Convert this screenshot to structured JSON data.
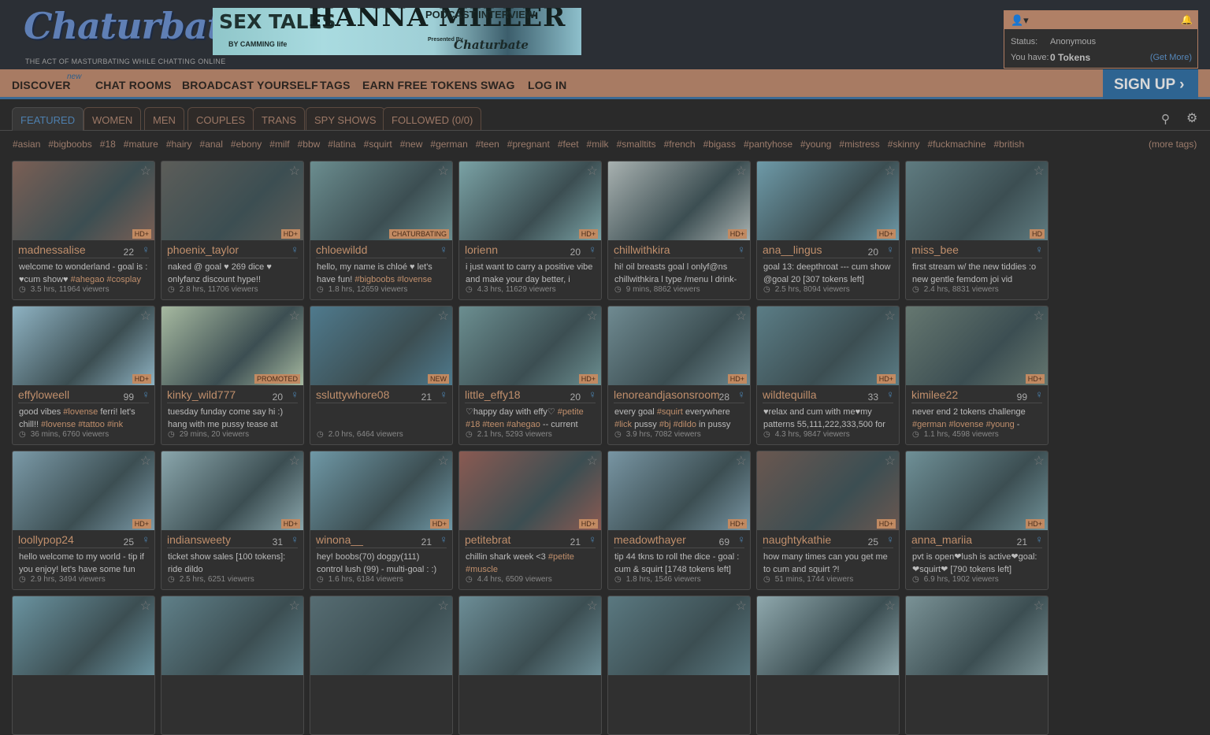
{
  "header": {
    "logo": "Chaturbate",
    "tagline": "THE ACT OF MASTURBATING WHILE CHATTING ONLINE",
    "banner": {
      "left": "SEX TALES",
      "by": "BY CAMMING life",
      "name": "HANNA MILLER",
      "right": "PODCAST INTERVIEW",
      "presented": "Presented By",
      "brand": "Chaturbate"
    }
  },
  "userbox": {
    "status_label": "Status:",
    "status_value": "Anonymous",
    "have_label": "You have:",
    "tokens": "0 Tokens",
    "get_more": "(Get More)",
    "user_icon": "user-icon",
    "bell_icon": "bell-icon"
  },
  "nav": {
    "items": [
      "DISCOVER",
      "CHAT ROOMS",
      "BROADCAST YOURSELF",
      "TAGS",
      "EARN FREE TOKENS",
      "SWAG",
      "LOG IN"
    ],
    "new_badge": "new",
    "signup": "SIGN UP"
  },
  "tabs": [
    "FEATURED",
    "WOMEN",
    "MEN",
    "COUPLES",
    "TRANS",
    "SPY SHOWS",
    "FOLLOWED (0/0)"
  ],
  "tags": [
    "#asian",
    "#bigboobs",
    "#18",
    "#mature",
    "#hairy",
    "#anal",
    "#ebony",
    "#milf",
    "#bbw",
    "#latina",
    "#squirt",
    "#new",
    "#german",
    "#teen",
    "#pregnant",
    "#feet",
    "#milk",
    "#smalltits",
    "#french",
    "#bigass",
    "#pantyhose",
    "#young",
    "#mistress",
    "#skinny",
    "#fuckmachine",
    "#british"
  ],
  "more_tags": "(more tags)",
  "colors": {
    "accent": "#a87b63",
    "link": "#4d7fae",
    "username": "#c08f6c",
    "signup": "#2e6491"
  },
  "rooms": [
    {
      "name": "madnessalise",
      "age": "22",
      "badge": "HD+",
      "subject": [
        "welcome to wonderland - goal is : ♥cum show♥ ",
        "#ahegao",
        " ",
        "#cosplay"
      ],
      "stats": "3.5 hrs, 11964 viewers",
      "tint": "#7a5f55"
    },
    {
      "name": "phoenix_taylor",
      "age": "",
      "badge": "HD+",
      "subject": [
        "naked @ goal ♥ 269 dice ♥ onlyfanz discount hype!!"
      ],
      "stats": "2.8 hrs, 11706 viewers",
      "tint": "#5c5d59"
    },
    {
      "name": "chloewildd",
      "age": "",
      "badge": "CHATURBATING",
      "subject": [
        "hello, my name is chloé ♥ let's have fun! ",
        "#bigboobs",
        " ",
        "#lovense"
      ],
      "stats": "1.8 hrs, 12659 viewers",
      "tint": "#6b8d8f"
    },
    {
      "name": "lorienn",
      "age": "20",
      "badge": "HD+",
      "subject": [
        "i just want to carry a positive vibe and make your day better, i"
      ],
      "stats": "4.3 hrs, 11629 viewers",
      "tint": "#7aa2a5"
    },
    {
      "name": "chillwithkira",
      "age": "",
      "badge": "HD+",
      "subject": [
        "hi! oil breasts goal l onlyf@ns chillwithkira l type /menu l drink-"
      ],
      "stats": "9 mins, 8862 viewers",
      "tint": "#a8b1b0"
    },
    {
      "name": "ana__lingus",
      "age": "20",
      "badge": "HD+",
      "subject": [
        "goal 13: deepthroat --- cum show @goal 20 [307 tokens left]"
      ],
      "stats": "2.5 hrs, 8094 viewers",
      "tint": "#6e9aa8"
    },
    {
      "name": "miss_bee",
      "age": "",
      "badge": "HD",
      "subject": [
        "first stream w/ the new tiddies :o new gentle femdom joi vid"
      ],
      "stats": "2.4 hrs, 8831 viewers",
      "tint": "#5f7b80"
    },
    {
      "name": "effyloweell",
      "age": "99",
      "badge": "HD+",
      "subject": [
        "good vibes ",
        "#lovense",
        " ferri! let's chill!! ",
        "#lovense",
        " ",
        "#tattoo",
        " ",
        "#ink"
      ],
      "stats": "36 mins, 6760 viewers",
      "tint": "#8eb2c2"
    },
    {
      "name": "kinky_wild777",
      "age": "20",
      "badge": "PROMOTED",
      "subject": [
        "tuesday funday come say hi :) hang with me pussy tease at"
      ],
      "stats": "29 mins, 20 viewers",
      "tint": "#a6b9a0"
    },
    {
      "name": "ssluttywhore08",
      "age": "21",
      "badge": "NEW",
      "subject": [
        ""
      ],
      "stats": "2.0 hrs, 6464 viewers",
      "tint": "#4f7a8d"
    },
    {
      "name": "little_effy18",
      "age": "20",
      "badge": "HD+",
      "subject": [
        "♡happy day with effy♡ ",
        "#petite",
        " ",
        "#18",
        " ",
        "#teen",
        " ",
        "#ahegao",
        " -- current"
      ],
      "stats": "2.1 hrs, 5293 viewers",
      "tint": "#6b8e90"
    },
    {
      "name": "lenoreandjasonsroom",
      "age": "28",
      "badge": "HD+",
      "subject": [
        "every goal ",
        "#squirt",
        " everywhere ",
        "#lick",
        " pussy ",
        "#bj",
        " ",
        "#dildo",
        " in pussy"
      ],
      "stats": "3.9 hrs, 7082 viewers",
      "tint": "#6f8a91"
    },
    {
      "name": "wildtequilla",
      "age": "33",
      "badge": "HD+",
      "subject": [
        "♥relax and cum with me♥my patterns 55,111,222,333,500 for"
      ],
      "stats": "4.3 hrs, 9847 viewers",
      "tint": "#5b7d86"
    },
    {
      "name": "kimilee22",
      "age": "99",
      "badge": "HD+",
      "subject": [
        "never end 2 tokens challenge ",
        "#german",
        " ",
        "#lovense",
        " ",
        "#young",
        " -"
      ],
      "stats": "1.1 hrs, 4598 viewers",
      "tint": "#657770"
    },
    {
      "name": "loollypop24",
      "age": "25",
      "badge": "HD+",
      "subject": [
        "hello welcome to my world - tip if you enjoy! let's have some fun"
      ],
      "stats": "2.9 hrs, 3494 viewers",
      "tint": "#7b9aa8"
    },
    {
      "name": "indiansweety",
      "age": "31",
      "badge": "HD+",
      "subject": [
        "ticket show sales [100 tokens]: ride dildo"
      ],
      "stats": "2.5 hrs, 6251 viewers",
      "tint": "#8aa6ac"
    },
    {
      "name": "winona__",
      "age": "21",
      "badge": "HD+",
      "subject": [
        "hey! boobs(70) doggy(111) control lush (99) - multi-goal : :)"
      ],
      "stats": "1.6 hrs, 6184 viewers",
      "tint": "#6f98a6"
    },
    {
      "name": "petitebrat",
      "age": "21",
      "badge": "HD+",
      "subject": [
        "chillin shark week <3 ",
        "#petite",
        " ",
        "#muscle"
      ],
      "stats": "4.4 hrs, 6509 viewers",
      "tint": "#8a5a52"
    },
    {
      "name": "meadowthayer",
      "age": "69",
      "badge": "HD+",
      "subject": [
        "tip 44 tkns to roll the dice - goal : cum & squirt [1748 tokens left]"
      ],
      "stats": "1.8 hrs, 1546 viewers",
      "tint": "#7895a3"
    },
    {
      "name": "naughtykathie",
      "age": "25",
      "badge": "HD+",
      "subject": [
        "how many times can you get me to cum and squirt ?!"
      ],
      "stats": "51 mins, 1744 viewers",
      "tint": "#6a5750"
    },
    {
      "name": "anna_mariia",
      "age": "21",
      "badge": "HD+",
      "subject": [
        "pvt is open❤lush is active❤goal: ❤squirt❤ [790 tokens left]"
      ],
      "stats": "6.9 hrs, 1902 viewers",
      "tint": "#6f9097"
    },
    {
      "name": "",
      "age": "",
      "badge": "",
      "subject": [
        ""
      ],
      "stats": "",
      "tint": "#6a93a0"
    },
    {
      "name": "",
      "age": "",
      "badge": "",
      "subject": [
        ""
      ],
      "stats": "",
      "tint": "#5f7f88"
    },
    {
      "name": "",
      "age": "",
      "badge": "",
      "subject": [
        ""
      ],
      "stats": "",
      "tint": "#566c72"
    },
    {
      "name": "",
      "age": "",
      "badge": "",
      "subject": [
        ""
      ],
      "stats": "",
      "tint": "#6c8d96"
    },
    {
      "name": "",
      "age": "",
      "badge": "",
      "subject": [
        ""
      ],
      "stats": "",
      "tint": "#5a7880"
    },
    {
      "name": "",
      "age": "",
      "badge": "",
      "subject": [
        ""
      ],
      "stats": "",
      "tint": "#8fa8ad"
    },
    {
      "name": "",
      "age": "",
      "badge": "",
      "subject": [
        ""
      ],
      "stats": "",
      "tint": "#7a9296"
    }
  ]
}
